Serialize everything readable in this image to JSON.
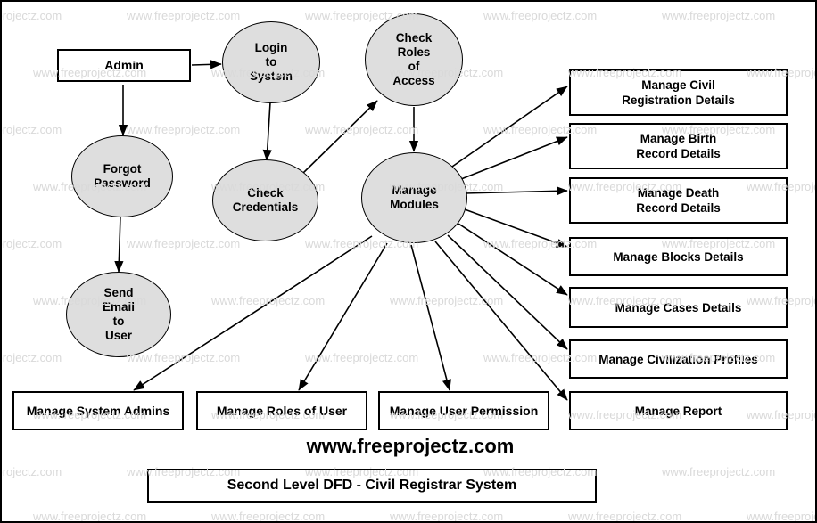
{
  "diagram": {
    "title": "Second Level DFD - Civil Registrar System",
    "site_label": "www.freeprojectz.com",
    "watermark_text": "www.freeprojectz.com",
    "colors": {
      "process_fill": "#dedede",
      "process_stroke": "#000000",
      "entity_fill": "#ffffff",
      "entity_stroke": "#000000",
      "watermark": "#d9d9d9",
      "background": "#ffffff"
    },
    "entities": [
      {
        "id": "admin",
        "label": "Admin"
      }
    ],
    "processes": [
      {
        "id": "login",
        "label": "Login\nto\nSystem"
      },
      {
        "id": "check_roles",
        "label": "Check\nRoles\nof\nAccess"
      },
      {
        "id": "forgot",
        "label": "Forgot\nPassword"
      },
      {
        "id": "check_cred",
        "label": "Check\nCredentials"
      },
      {
        "id": "manage_modules",
        "label": "Manage\nModules"
      },
      {
        "id": "send_email",
        "label": "Send\nEmail\nto\nUser"
      }
    ],
    "right_modules": [
      {
        "id": "civil_reg",
        "label": "Manage Civil\nRegistration Details"
      },
      {
        "id": "birth",
        "label": "Manage Birth\nRecord Details"
      },
      {
        "id": "death",
        "label": "Manage Death\nRecord Details"
      },
      {
        "id": "blocks",
        "label": "Manage Blocks Details"
      },
      {
        "id": "cases",
        "label": "Manage Cases Details"
      },
      {
        "id": "civilization",
        "label": "Manage Civilization Profiles"
      },
      {
        "id": "report",
        "label": "Manage Report"
      }
    ],
    "bottom_modules": [
      {
        "id": "sys_admins",
        "label": "Manage System Admins"
      },
      {
        "id": "roles_user",
        "label": "Manage Roles of User"
      },
      {
        "id": "user_permission",
        "label": "Manage User Permission"
      }
    ]
  }
}
